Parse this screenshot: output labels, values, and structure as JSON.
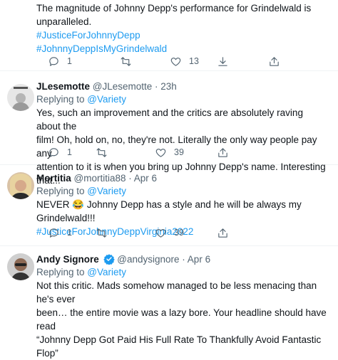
{
  "tweets": [
    {
      "text_lines": [
        "The magnitude of Johnny Depp's performance for Grindelwald is",
        "unparalleled."
      ],
      "hashtags": [
        "#JusticeForJohnnyDepp",
        "#JohnnyDeppIsMyGrindelwald"
      ],
      "stats": {
        "replies": "1",
        "retweets": "",
        "likes": "13"
      }
    },
    {
      "name": "JLesemotte",
      "handle": "@JLesemotte · 23h",
      "replying_prefix": "Replying to ",
      "replying_to": "@Variety",
      "text_lines": [
        "Yes, such an improvement and the critics are absolutely raving about the",
        "film! Oh, hold on, no, they're not. Literally the only way people pay any",
        "attention to it is when you bring up Johnny Depp's name. Interesting that..."
      ],
      "stats": {
        "replies": "1",
        "retweets": "",
        "likes": "39"
      }
    },
    {
      "name": "Mortitia",
      "handle": "@mortitia88 · Apr 6",
      "replying_prefix": "Replying to ",
      "replying_to": "@Variety",
      "text_lines": [
        "NEVER 😂 Johnny Depp has a style and he will be always my Grindelwald!!!"
      ],
      "hashtags": [
        "#JusticeForJohnnyDeppVirginia2022"
      ],
      "stats": {
        "replies": "1",
        "retweets": "",
        "likes": "39"
      }
    },
    {
      "name": "Andy Signore",
      "handle": "@andysignore · Apr 6",
      "replying_prefix": "Replying to ",
      "replying_to": "@Variety",
      "text_lines": [
        "Not this critic. Mads somehow managed to be less menacing than he's ever",
        "been…  the entire movie was a lazy bore. Your headline should have read",
        "“Johnny Depp Got Paid His Full Rate To Thankfully Avoid Fantastic Flop”"
      ]
    }
  ],
  "icons": {
    "reply": "reply-icon",
    "retweet": "retweet-icon",
    "like": "heart-icon",
    "share": "share-icon",
    "verified": "verified-badge-icon"
  },
  "colors": {
    "link": "#1d9bf0",
    "secondary_text": "#536471",
    "divider": "#eff3f4"
  }
}
